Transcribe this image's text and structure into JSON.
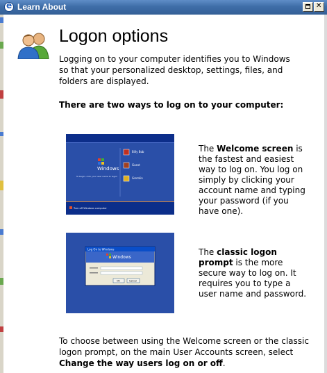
{
  "window": {
    "title": "Learn About"
  },
  "page": {
    "title": "Logon options",
    "intro": "Logging on to your computer identifies you to Windows so that your personalized desktop, settings, files, and folders are displayed.",
    "subheading": "There are two ways to log on to your computer:",
    "welcome": {
      "pre": "The ",
      "bold": "Welcome screen",
      "post": " is the fastest and easiest way to log on. You log on simply by clicking your account name and typing your password (if you have one)."
    },
    "classic": {
      "pre": "The ",
      "bold": "classic logon prompt",
      "post": " is the more secure way to log on. It requires you to type a user name and password."
    },
    "footer": {
      "pre": "To choose between using the Welcome screen or the classic logon prompt, on the main User Accounts screen, select ",
      "bold": "Change the way users log on or off",
      "post": "."
    }
  },
  "thumbnails": {
    "welcome_logo": "Windows",
    "welcome_caption": "To begin, click your user name to logon",
    "welcome_users": [
      "Billy Bob",
      "Guest",
      "Gremlin"
    ],
    "welcome_turnoff": "Turn off Windows computer",
    "classic_window_title": "Log On to Windows",
    "classic_logo": "Windows",
    "classic_ok": "OK",
    "classic_cancel": "Cancel"
  },
  "colors": {
    "titlebar": "#3f6ea8",
    "xp_blue": "#2a4fa8",
    "xp_dark_blue": "#0c2e8a"
  }
}
